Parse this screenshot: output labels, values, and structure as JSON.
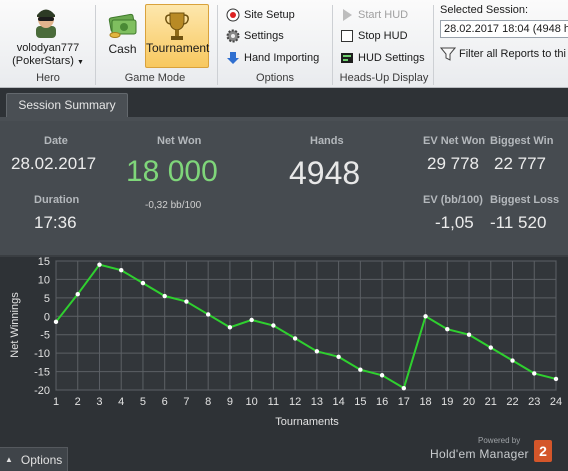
{
  "ribbon": {
    "hero": {
      "name": "volodyan777",
      "site": "(PokerStars)",
      "caption": "Hero"
    },
    "game_mode": {
      "cash_label": "Cash",
      "tournament_label": "Tournament",
      "caption": "Game Mode"
    },
    "options": {
      "site_setup_label": "Site Setup",
      "settings_label": "Settings",
      "hand_importing_label": "Hand Importing",
      "caption": "Options"
    },
    "hud": {
      "start_label": "Start HUD",
      "stop_label": "Stop HUD",
      "settings_label": "HUD Settings",
      "caption": "Heads-Up Display"
    },
    "session": {
      "title": "Selected Session:",
      "value": "28.02.2017 18:04  (4948 h",
      "filter_label": "Filter all Reports to thi"
    }
  },
  "tab": {
    "label": "Session Summary"
  },
  "stats": {
    "date_label": "Date",
    "date_value": "28.02.2017",
    "duration_label": "Duration",
    "duration_value": "17:36",
    "net_won_label": "Net Won",
    "net_won_value": "18 000",
    "net_won_bb": "-0,32 bb/100",
    "hands_label": "Hands",
    "hands_value": "4948",
    "ev_net_won_label": "EV Net Won",
    "ev_net_won_value": "29 778",
    "biggest_win_label": "Biggest Win",
    "biggest_win_value": "22 777",
    "ev_bb_label": "EV (bb/100)",
    "ev_bb_value": "-1,05",
    "biggest_loss_label": "Biggest Loss",
    "biggest_loss_value": "-11 520"
  },
  "footer": {
    "options_label": "Options",
    "powered_by": "Powered by",
    "brand": "Hold'em Manager",
    "brand_badge": "2"
  },
  "colors": {
    "accent_green": "#7fd67a",
    "line_green": "#2fd02f",
    "tournament_active": "#f8c85f"
  },
  "chart_data": {
    "type": "line",
    "xlabel": "Tournaments",
    "ylabel": "Net Winnings",
    "x": [
      1,
      2,
      3,
      4,
      5,
      6,
      7,
      8,
      9,
      10,
      11,
      12,
      13,
      14,
      15,
      16,
      17,
      18,
      19,
      20,
      21,
      22,
      23,
      24
    ],
    "y": [
      -1.5,
      6,
      14,
      12.5,
      9,
      5.5,
      4,
      0.5,
      -3,
      -1,
      -2.5,
      -6,
      -9.5,
      -11,
      -14.5,
      -16,
      -19.5,
      0,
      -3.5,
      -5,
      -8.5,
      -12,
      -15.5,
      -17
    ],
    "yticks": [
      15,
      10,
      5,
      0,
      -5,
      -10,
      -15,
      -20
    ],
    "ylim": [
      -20,
      15
    ],
    "xlim": [
      1,
      24
    ],
    "grid": true
  }
}
